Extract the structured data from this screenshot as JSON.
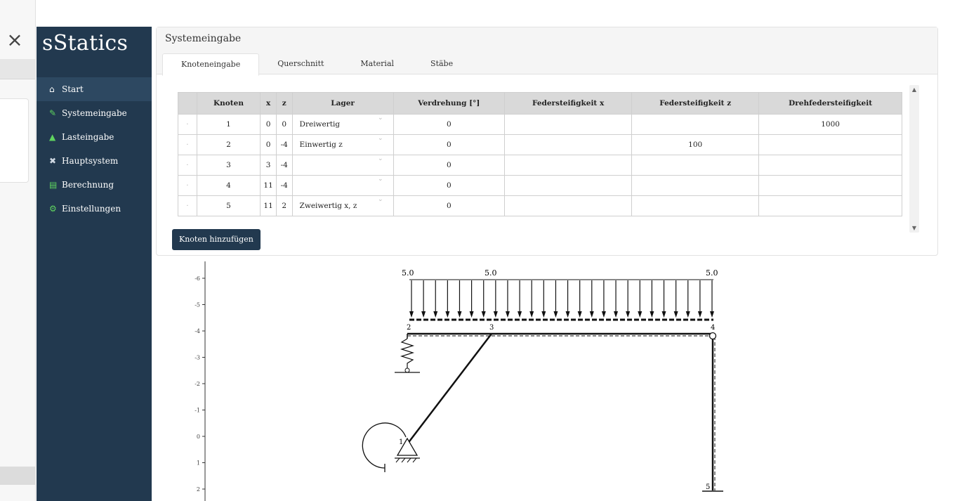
{
  "overlay": {
    "close_icon": "×"
  },
  "app": {
    "title": "sStatics"
  },
  "sidebar": {
    "items": [
      {
        "label": "Start",
        "icon": "home-icon",
        "glyph": "⌂"
      },
      {
        "label": "Systemeingabe",
        "icon": "pencil-icon",
        "glyph": "✎"
      },
      {
        "label": "Lasteingabe",
        "icon": "weight-icon",
        "glyph": "▲"
      },
      {
        "label": "Hauptsystem",
        "icon": "tools-icon",
        "glyph": "✖"
      },
      {
        "label": "Berechnung",
        "icon": "calculator-icon",
        "glyph": "▤"
      },
      {
        "label": "Einstellungen",
        "icon": "gear-icon",
        "glyph": "⚙"
      }
    ]
  },
  "panel": {
    "title": "Systemeingabe",
    "tabs": [
      "Knoteneingabe",
      "Querschnitt",
      "Material",
      "Stäbe"
    ],
    "active_tab": "Knoteneingabe",
    "table": {
      "headers": [
        "",
        "Knoten",
        "x",
        "z",
        "Lager",
        "Verdrehung [°]",
        "Federsteifigkeit x",
        "Federsteifigkeit z",
        "Drehfedersteifigkeit"
      ],
      "rows": [
        [
          "1",
          "0",
          "0",
          "Dreiwertig",
          "0",
          "",
          "",
          "1000"
        ],
        [
          "2",
          "0",
          "-4",
          "Einwertig z",
          "0",
          "",
          "100",
          ""
        ],
        [
          "3",
          "3",
          "-4",
          "",
          "0",
          "",
          "",
          ""
        ],
        [
          "4",
          "11",
          "-4",
          "",
          "0",
          "",
          "",
          ""
        ],
        [
          "5",
          "11",
          "2",
          "Zweiwertig x, z",
          "0",
          "",
          "",
          ""
        ]
      ]
    },
    "add_button": "Knoten hinzufügen"
  },
  "plot": {
    "y_ticks": [
      "-6",
      "-5",
      "-4",
      "-3",
      "-2",
      "-1",
      "0",
      "1",
      "2"
    ],
    "load_labels": [
      "5.0",
      "5.0",
      "5.0"
    ],
    "node_labels": [
      "1",
      "2",
      "3",
      "4",
      "5"
    ]
  },
  "colors": {
    "sidebar": "#22394f",
    "accent": "#22394f"
  }
}
